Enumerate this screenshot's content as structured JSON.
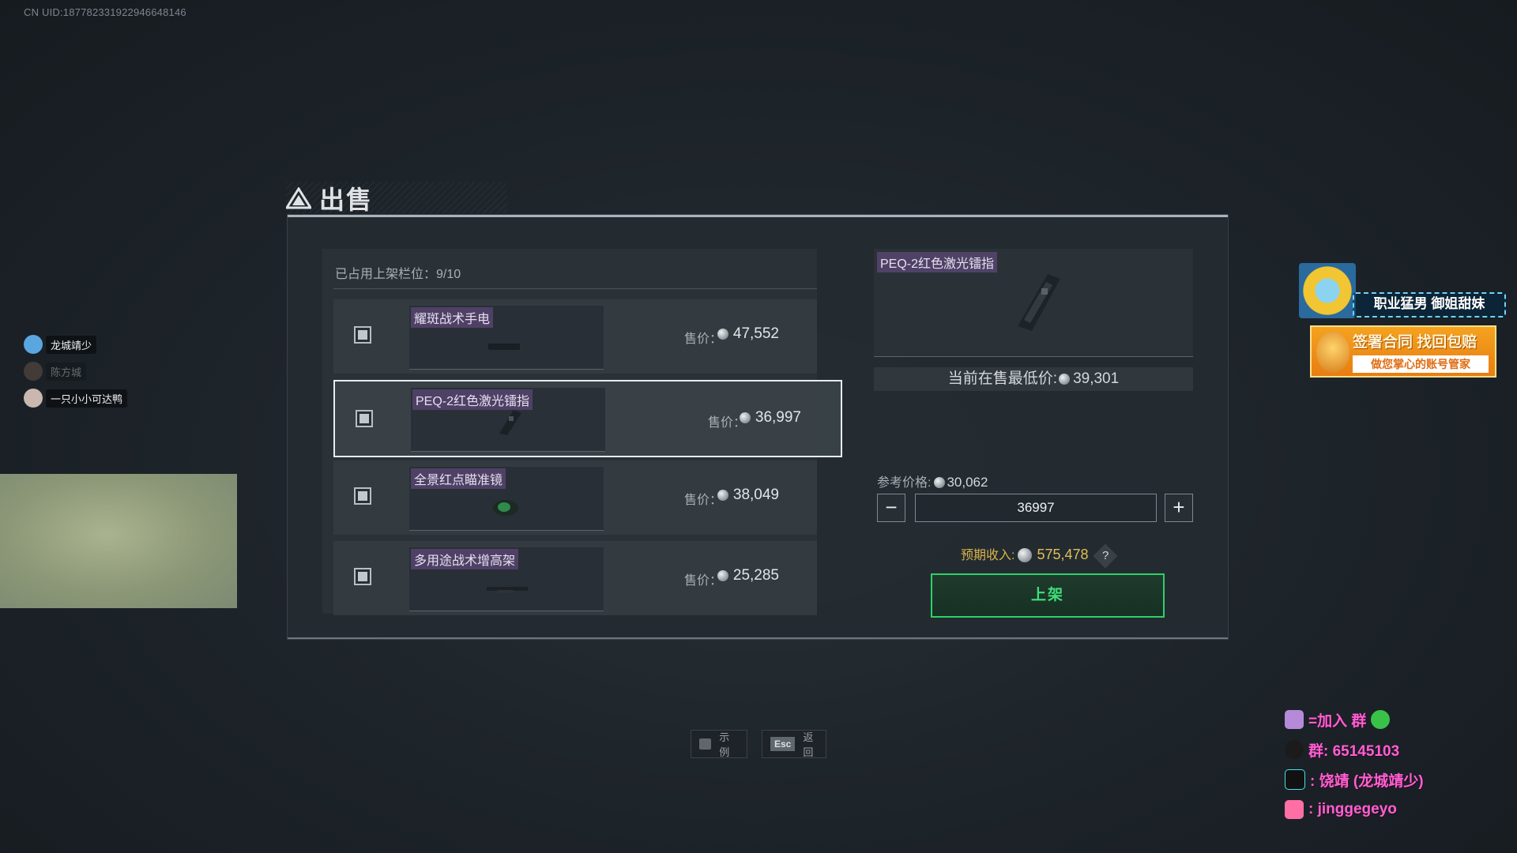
{
  "uid_text": "CN UID:1877823319229466481­46",
  "title": "出售",
  "slots": {
    "label": "已占用上架栏位：",
    "value": "9/10"
  },
  "items": [
    {
      "name": "耀斑战术手电",
      "price_label": "售价：",
      "price": "47,552",
      "selected": false
    },
    {
      "name": "PEQ-2红色激光镭指",
      "price_label": "售价：",
      "price": "36,997",
      "selected": true
    },
    {
      "name": "全景红点瞄准镜",
      "price_label": "售价：",
      "price": "38,049",
      "selected": false
    },
    {
      "name": "多用途战术增高架",
      "price_label": "售价：",
      "price": "25,285",
      "selected": false
    }
  ],
  "detail": {
    "name": "PEQ-2红色激光镭指",
    "lowest_label": "当前在售最低价:",
    "lowest_price": "39,301",
    "ref_label": "参考价格:",
    "ref_price": "30,062",
    "minus": "−",
    "plus": "+",
    "quantity": "36997",
    "income_label": "预期收入:",
    "income_value": "575,478",
    "help": "?",
    "list_button": "上架"
  },
  "hints": [
    {
      "key": "",
      "label": "示例"
    },
    {
      "key": "Esc",
      "label": "返回"
    }
  ],
  "viewers": [
    {
      "name": "龙城靖少"
    },
    {
      "name": "陈方城"
    },
    {
      "name": "一只小小可达鸭"
    }
  ],
  "ads": {
    "top": "职业猛男 御姐甜妹",
    "banner_line1": "签署合同 找回包赔",
    "banner_line2": "做您掌心的账号管家"
  },
  "socials": [
    {
      "text": "=加入  群"
    },
    {
      "text": "群: 65145103"
    },
    {
      "text": ": 饶靖 (龙城靖少)"
    },
    {
      "text": ": jinggegeyo"
    }
  ],
  "colors": {
    "accent_green": "#2fd06a",
    "income_gold": "#d7b34a",
    "name_tag_purple": "#6e508c"
  }
}
